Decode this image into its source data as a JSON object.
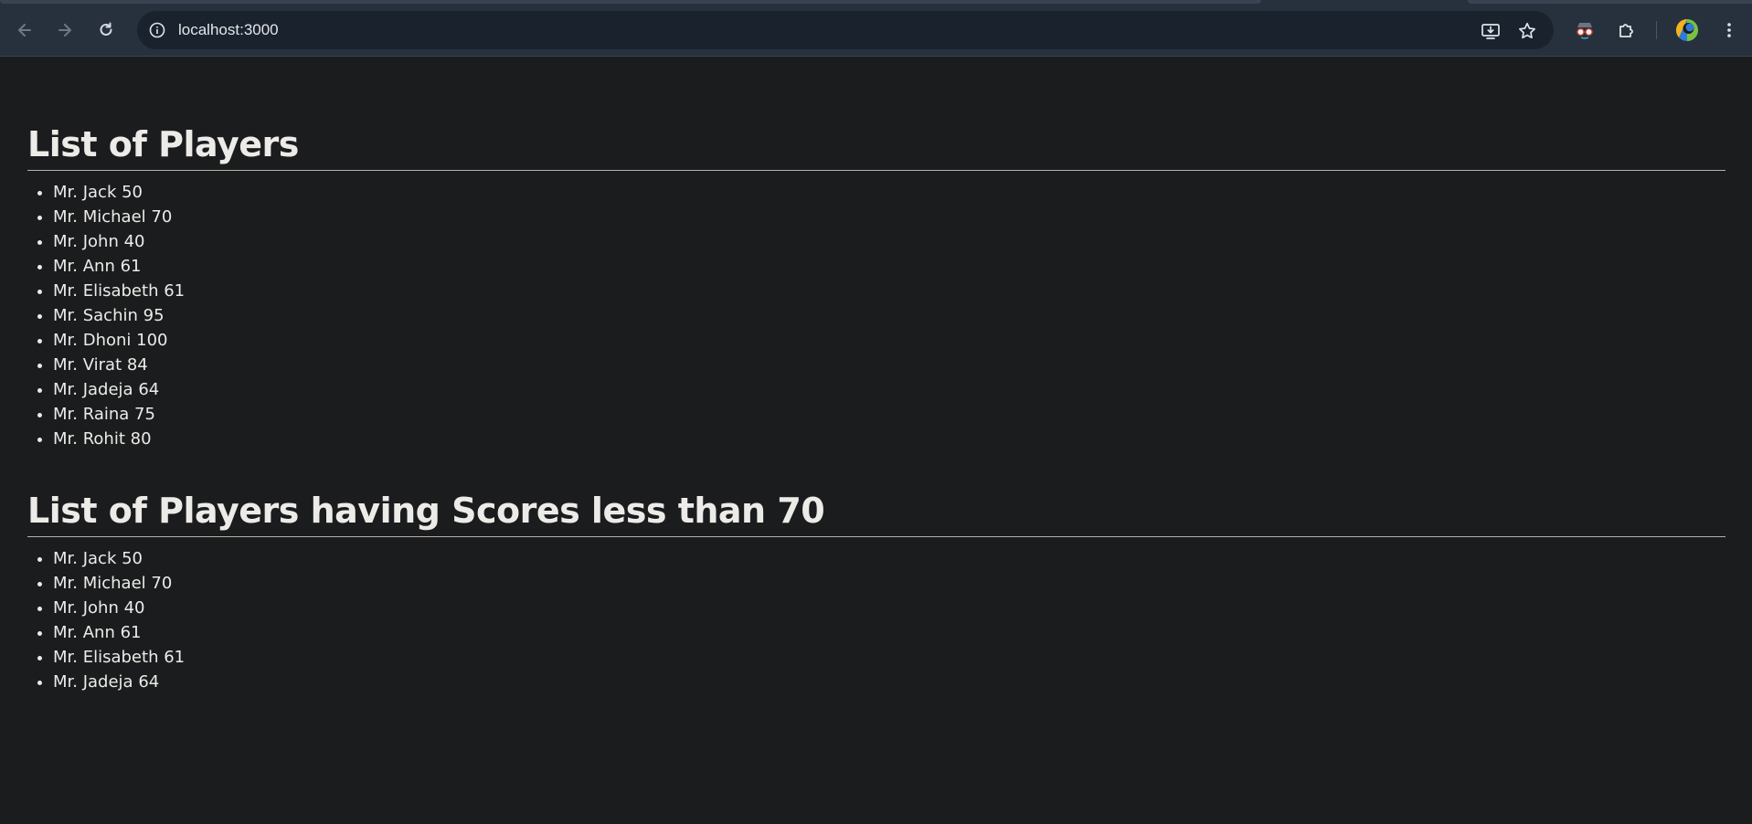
{
  "browser": {
    "url": "localhost:3000",
    "icons": {
      "back": "back-arrow-icon",
      "forward": "forward-arrow-icon",
      "reload": "reload-icon",
      "site_info": "info-icon",
      "install": "install-app-icon",
      "bookmark": "star-icon",
      "incognito": "spy-glasses-icon",
      "extensions": "puzzle-icon",
      "profile": "profile-avatar",
      "menu": "kebab-menu-icon"
    }
  },
  "sections": [
    {
      "heading": "List of Players",
      "players": [
        "Mr. Jack 50",
        "Mr. Michael 70",
        "Mr. John 40",
        "Mr. Ann 61",
        "Mr. Elisabeth 61",
        "Mr. Sachin 95",
        "Mr. Dhoni 100",
        "Mr. Virat 84",
        "Mr. Jadeja 64",
        "Mr. Raina 75",
        "Mr. Rohit 80"
      ]
    },
    {
      "heading": "List of Players having Scores less than 70",
      "players": [
        "Mr. Jack 50",
        "Mr. Michael 70",
        "Mr. John 40",
        "Mr. Ann 61",
        "Mr. Elisabeth 61",
        "Mr. Jadeja 64"
      ]
    }
  ],
  "colors": {
    "page_background": "#1b1c1e",
    "text": "#ecebe8",
    "toolbar": "#27303d",
    "omnibox": "#1a222d"
  }
}
